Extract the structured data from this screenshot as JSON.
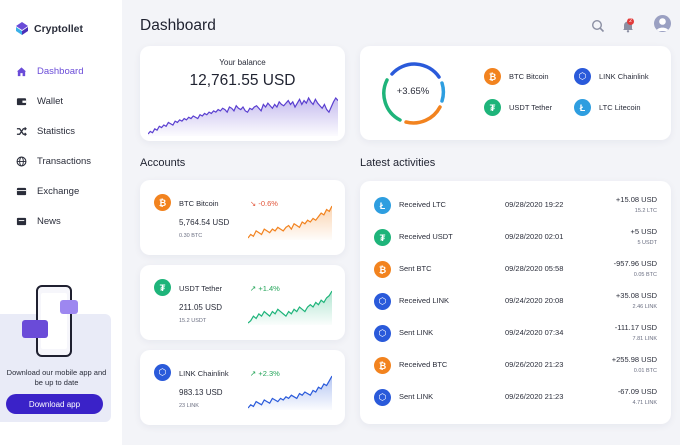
{
  "app": {
    "name": "Cryptollet"
  },
  "nav": [
    {
      "label": "Dashboard",
      "icon": "home-icon",
      "active": true
    },
    {
      "label": "Wallet",
      "icon": "wallet-icon",
      "active": false
    },
    {
      "label": "Statistics",
      "icon": "shuffle-icon",
      "active": false
    },
    {
      "label": "Transactions",
      "icon": "globe-icon",
      "active": false
    },
    {
      "label": "Exchange",
      "icon": "exchange-icon",
      "active": false
    },
    {
      "label": "News",
      "icon": "news-icon",
      "active": false
    }
  ],
  "promo": {
    "text": "Download our mobile app and be up to date",
    "button_label": "Download app"
  },
  "header": {
    "title": "Dashboard",
    "notification_count": "2"
  },
  "balance": {
    "label": "Your balance",
    "value": "12,761.55 USD",
    "series": [
      10,
      12,
      11,
      14,
      13,
      16,
      15,
      17,
      16,
      19,
      18,
      17,
      20,
      19,
      21,
      20,
      22,
      21,
      23,
      22,
      24,
      23,
      22,
      25,
      24,
      26,
      25,
      27,
      26,
      28,
      27,
      29,
      28,
      30,
      29,
      27,
      31,
      30,
      28,
      32,
      30,
      29,
      31,
      28,
      27,
      30,
      29,
      31,
      32,
      30,
      28,
      33,
      31,
      34,
      32,
      30,
      33,
      31,
      35,
      33,
      32,
      34,
      36,
      33,
      35,
      31,
      34,
      37,
      33,
      36,
      34,
      38,
      35,
      33,
      37,
      34,
      32,
      30,
      33,
      29,
      27,
      31,
      35,
      38,
      36
    ]
  },
  "portfolio": {
    "change": "+3.65%",
    "legend": [
      {
        "label": "BTC Bitcoin",
        "coin": "btc",
        "color": "#f2831f"
      },
      {
        "label": "LINK Chainlink",
        "coin": "link",
        "color": "#2a5ada"
      },
      {
        "label": "USDT Tether",
        "coin": "usdt",
        "color": "#1eb47a"
      },
      {
        "label": "LTC Litecoin",
        "coin": "ltc",
        "color": "#2e9ee0"
      }
    ]
  },
  "accounts": {
    "title": "Accounts",
    "items": [
      {
        "name": "BTC Bitcoin",
        "coin": "btc",
        "change": "-0.6%",
        "direction": "down",
        "amount": "5,764.54 USD",
        "sub": "0.30 BTC",
        "color": "#f2831f",
        "series": [
          8,
          10,
          9,
          12,
          11,
          10,
          13,
          12,
          11,
          13,
          12,
          14,
          13,
          12,
          14,
          15,
          13,
          16,
          15,
          14,
          17,
          16,
          18,
          17,
          19,
          18,
          20,
          22,
          21,
          24,
          23,
          26
        ]
      },
      {
        "name": "USDT Tether",
        "coin": "usdt",
        "change": "+1.4%",
        "direction": "up",
        "amount": "211.05 USD",
        "sub": "15.2 USDT",
        "color": "#1eb47a",
        "series": [
          8,
          9,
          11,
          10,
          12,
          11,
          13,
          12,
          11,
          13,
          12,
          14,
          13,
          12,
          11,
          13,
          12,
          14,
          13,
          15,
          14,
          13,
          15,
          16,
          15,
          17,
          16,
          18,
          17,
          19,
          20,
          22
        ]
      },
      {
        "name": "LINK Chainlink",
        "coin": "link",
        "change": "+2.3%",
        "direction": "up",
        "amount": "983.13 USD",
        "sub": "23 LINK",
        "color": "#2a5ada",
        "series": [
          6,
          8,
          7,
          10,
          9,
          8,
          11,
          10,
          9,
          12,
          11,
          10,
          12,
          11,
          13,
          12,
          14,
          13,
          12,
          15,
          14,
          16,
          15,
          14,
          17,
          16,
          19,
          18,
          21,
          20,
          23,
          26
        ]
      }
    ]
  },
  "activities": {
    "title": "Latest activities",
    "items": [
      {
        "label": "Received LTC",
        "coin": "ltc",
        "date": "09/28/2020 19:22",
        "amount": "+15.08 USD",
        "sub": "15.2 LTC"
      },
      {
        "label": "Received USDT",
        "coin": "usdt",
        "date": "09/28/2020 02:01",
        "amount": "+5 USD",
        "sub": "5 USDT"
      },
      {
        "label": "Sent BTC",
        "coin": "btc",
        "date": "09/28/2020 05:58",
        "amount": "-957.96 USD",
        "sub": "0.05 BTC"
      },
      {
        "label": "Received LINK",
        "coin": "link",
        "date": "09/24/2020 20:08",
        "amount": "+35.08 USD",
        "sub": "2.46 LINK"
      },
      {
        "label": "Sent LINK",
        "coin": "link",
        "date": "09/24/2020 07:34",
        "amount": "-111.17 USD",
        "sub": "7.81 LINK"
      },
      {
        "label": "Received BTC",
        "coin": "btc",
        "date": "09/26/2020 21:23",
        "amount": "+255.98 USD",
        "sub": "0.01 BTC"
      },
      {
        "label": "Sent LINK",
        "coin": "link",
        "date": "09/26/2020 21:23",
        "amount": "-67.09 USD",
        "sub": "4.71 LINK"
      }
    ]
  }
}
